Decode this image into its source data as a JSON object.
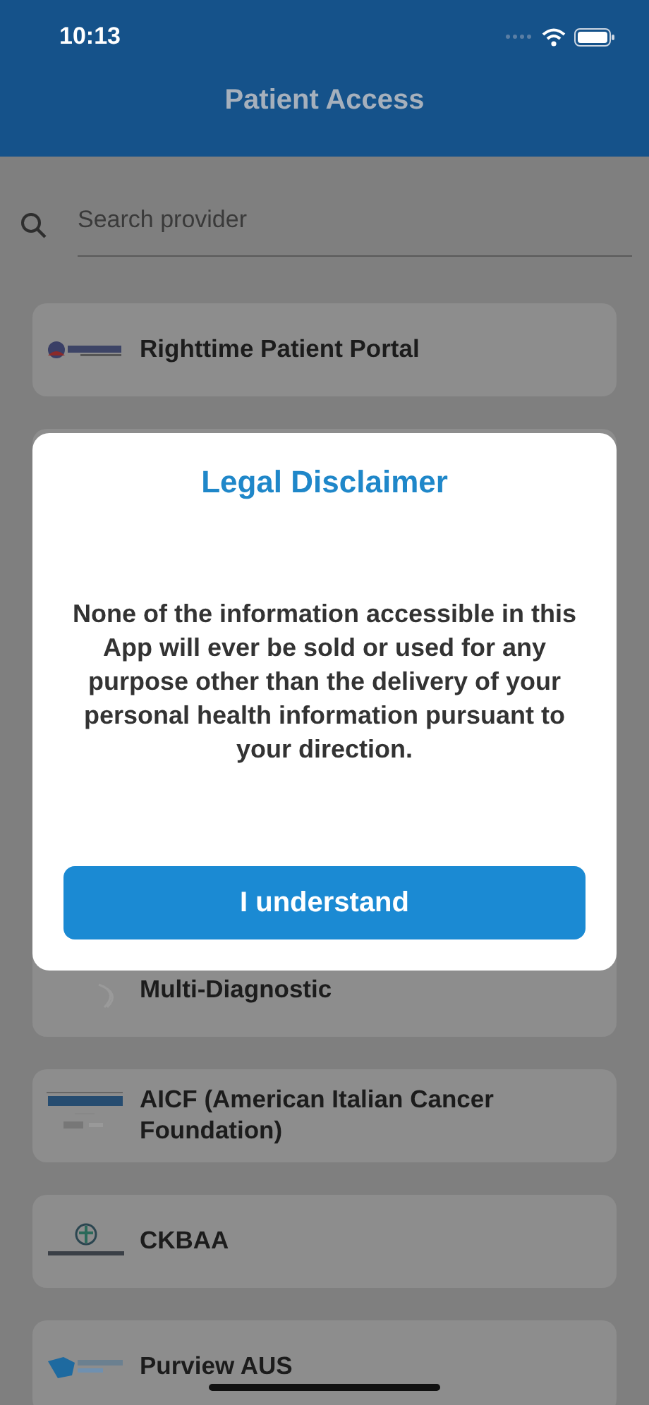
{
  "status_bar": {
    "time": "10:13"
  },
  "header": {
    "title": "Patient Access"
  },
  "search": {
    "placeholder": "Search provider"
  },
  "providers": [
    {
      "name": "Righttime Patient Portal",
      "kind": "righttime"
    },
    {
      "name": "Multi-Diagnostic",
      "kind": "multi"
    },
    {
      "name": "AICF (American Italian Cancer Foundation)",
      "kind": "aicf"
    },
    {
      "name": "CKBAA",
      "kind": "ckbaa"
    },
    {
      "name": "Purview AUS",
      "kind": "purview"
    }
  ],
  "dialog": {
    "title": "Legal Disclaimer",
    "message": "None of the information accessible in this App will ever be sold or used for any purpose other than the delivery of your personal health information pursuant to your direction.",
    "button": "I understand"
  }
}
